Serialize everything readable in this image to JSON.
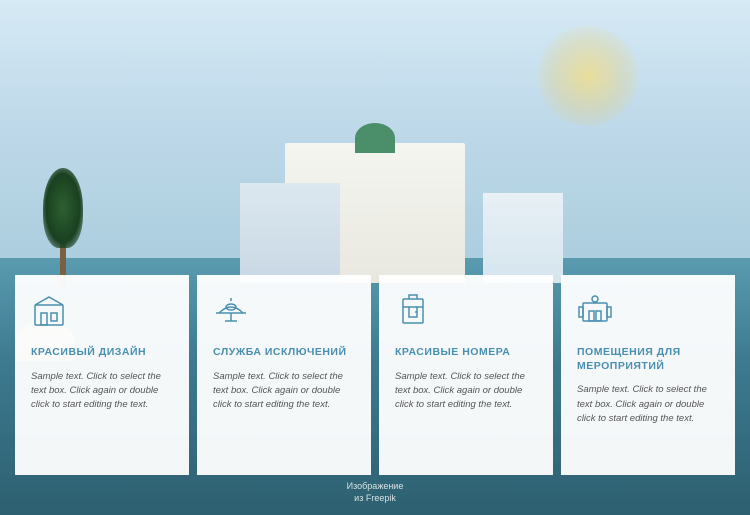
{
  "background": {
    "alt": "Hotel resort with pool background"
  },
  "image_credit": {
    "line1": "Изображение",
    "line2": "из Freepik"
  },
  "cards": [
    {
      "id": "beautiful-design",
      "icon": "hotel-icon",
      "title": "КРАСИВЫЙ ДИЗАЙН",
      "text": "Sample text. Click to select the text box. Click again or double click to start editing the text."
    },
    {
      "id": "exceptional-service",
      "icon": "service-icon",
      "title": "СЛУЖБА ИСКЛЮЧЕНИЙ",
      "text": "Sample text. Click to select the text box. Click again or double click to start editing the text."
    },
    {
      "id": "beautiful-rooms",
      "icon": "room-icon",
      "title": "КРАСИВЫЕ НОМЕРА",
      "text": "Sample text. Click to select the text box. Click again or double click to start editing the text."
    },
    {
      "id": "event-venues",
      "icon": "venue-icon",
      "title": "ПОМЕЩЕНИЯ ДЛЯ МЕРОПРИЯТИЙ",
      "text": "Sample text. Click to select the text box. Click again or double click to start editing the text."
    }
  ]
}
